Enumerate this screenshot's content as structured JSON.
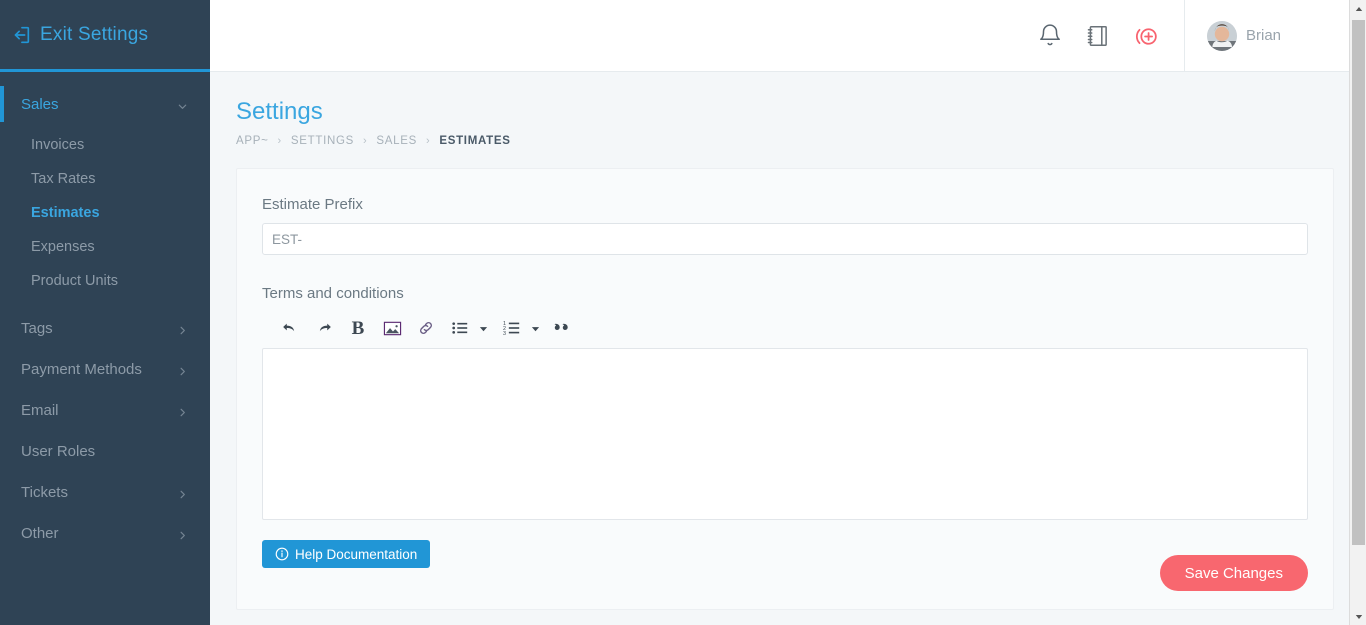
{
  "sidebar": {
    "exit": {
      "label": "Exit Settings",
      "icon": "sign-out-icon"
    },
    "groups": [
      {
        "label": "Sales",
        "active": true,
        "icon": "chevron-down-icon",
        "items": [
          {
            "label": "Invoices",
            "current": false
          },
          {
            "label": "Tax Rates",
            "current": false
          },
          {
            "label": "Estimates",
            "current": true
          },
          {
            "label": "Expenses",
            "current": false
          },
          {
            "label": "Product Units",
            "current": false
          }
        ]
      }
    ],
    "links": [
      {
        "label": "Tags",
        "icon": "chevron-right-icon",
        "has_chevron": true
      },
      {
        "label": "Payment Methods",
        "icon": "chevron-right-icon",
        "has_chevron": true
      },
      {
        "label": "Email",
        "icon": "chevron-right-icon",
        "has_chevron": true
      },
      {
        "label": "User Roles",
        "icon": "",
        "has_chevron": false
      },
      {
        "label": "Tickets",
        "icon": "chevron-right-icon",
        "has_chevron": true
      },
      {
        "label": "Other",
        "icon": "chevron-right-icon",
        "has_chevron": true
      }
    ]
  },
  "topbar": {
    "icons": [
      {
        "name": "bell-icon"
      },
      {
        "name": "notebook-icon"
      },
      {
        "name": "add-circle-icon"
      }
    ],
    "user": {
      "name": "Brian",
      "avatar": "user-avatar"
    }
  },
  "page": {
    "title": "Settings",
    "breadcrumb": [
      {
        "label": "APP~",
        "current": false
      },
      {
        "label": "SETTINGS",
        "current": false
      },
      {
        "label": "SALES",
        "current": false
      },
      {
        "label": "ESTIMATES",
        "current": true
      }
    ],
    "separator": "›"
  },
  "form": {
    "prefix_label": "Estimate Prefix",
    "prefix_value": "EST-",
    "prefix_placeholder": "EST-",
    "terms_label": "Terms and conditions",
    "terms_value": "",
    "terms_placeholder": ""
  },
  "editor": {
    "tools": [
      {
        "name": "undo-icon",
        "label": "Undo"
      },
      {
        "name": "redo-icon",
        "label": "Redo"
      },
      {
        "name": "bold-icon",
        "label": "B"
      },
      {
        "name": "image-icon",
        "label": "Insert image"
      },
      {
        "name": "link-icon",
        "label": "Insert link"
      },
      {
        "name": "bullet-list-icon",
        "label": "Bulleted list"
      },
      {
        "name": "bullet-list-caret-icon",
        "label": "Bulleted list options"
      },
      {
        "name": "numbered-list-icon",
        "label": "Numbered list"
      },
      {
        "name": "numbered-list-caret-icon",
        "label": "Numbered list options"
      },
      {
        "name": "blockquote-icon",
        "label": "““"
      }
    ],
    "bold_glyph": "B",
    "quote_glyph": "““"
  },
  "actions": {
    "help_label": "Help Documentation",
    "help_icon": "info-circle-icon",
    "save_label": "Save Changes"
  },
  "colors": {
    "sidebar_bg": "#2f4355",
    "accent_blue": "#2196d6",
    "link_blue": "#3aa6e0",
    "save_red": "#f8676f",
    "add_icon_red": "#f8636f",
    "muted_text": "#8d9ba8",
    "page_bg": "#f4f7f9",
    "card_bg": "#f9fbfc"
  },
  "scrollbar": {
    "thumb_top_pct": 3,
    "thumb_height_pct": 84
  }
}
